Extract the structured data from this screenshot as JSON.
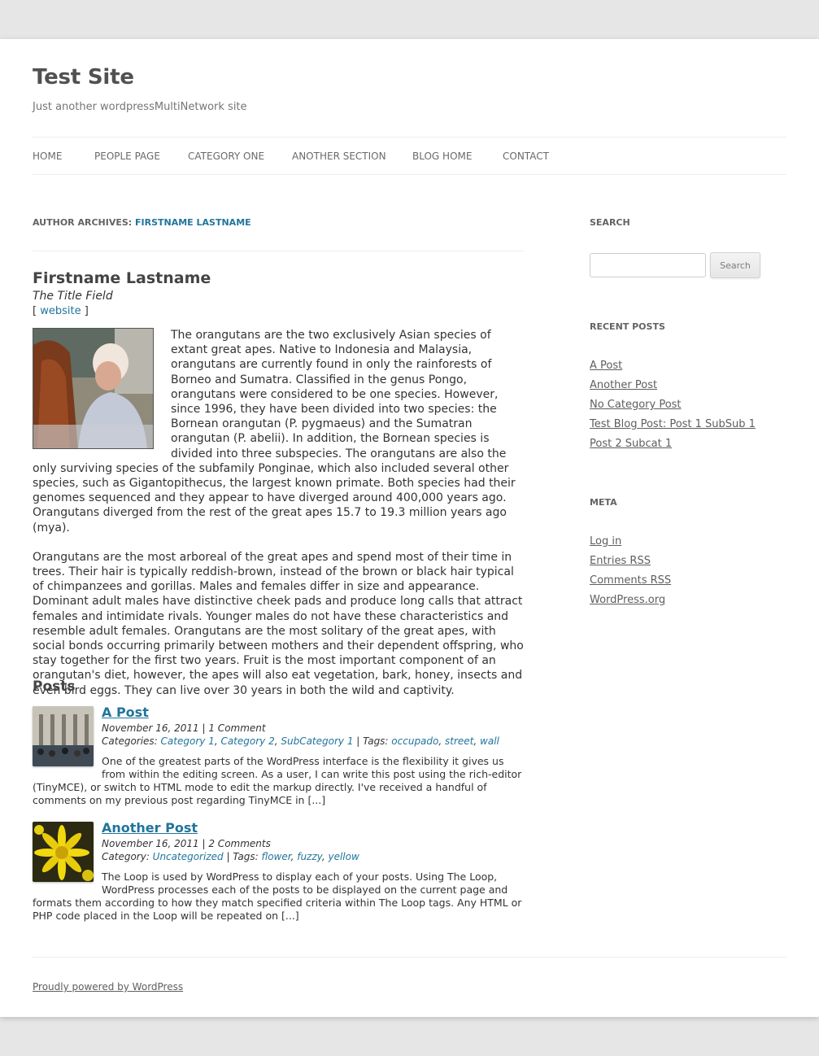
{
  "site": {
    "title": "Test Site",
    "description": "Just another wordpressMultiNetwork site"
  },
  "nav": [
    "HOME",
    "PEOPLE PAGE",
    "CATEGORY ONE",
    "ANOTHER SECTION",
    "BLOG HOME",
    "CONTACT"
  ],
  "archive": {
    "prefix": "AUTHOR ARCHIVES: ",
    "author_link": "FIRSTNAME LASTNAME"
  },
  "author": {
    "name": "Firstname Lastname",
    "title_field": "The Title Field",
    "website_open": "[ ",
    "website_label": "website",
    "website_close": " ]",
    "bio": [
      "The orangutans are the two exclusively Asian species of extant great apes. Native to Indonesia and Malaysia, orangutans are currently found in only the rainforests of Borneo and Sumatra. Classified in the genus Pongo, orangutans were considered to be one species. However, since 1996, they have been divided into two species: the Bornean orangutan (P. pygmaeus) and the Sumatran orangutan (P. abelii). In addition, the Bornean species is divided into three subspecies. The orangutans are also the only surviving species of the subfamily Ponginae, which also included several other species, such as Gigantopithecus, the largest known primate. Both species had their genomes sequenced and they appear to have diverged around 400,000 years ago. Orangutans diverged from the rest of the great apes 15.7 to 19.3 million years ago (mya).",
      "Orangutans are the most arboreal of the great apes and spend most of their time in trees. Their hair is typically reddish-brown, instead of the brown or black hair typical of chimpanzees and gorillas. Males and females differ in size and appearance. Dominant adult males have distinctive cheek pads and produce long calls that attract females and intimidate rivals. Younger males do not have these characteristics and resemble adult females. Orangutans are the most solitary of the great apes, with social bonds occurring primarily between mothers and their dependent offspring, who stay together for the first two years. Fruit is the most important component of an orangutan's diet, however, the apes will also eat vegetation, bark, honey, insects and even bird eggs. They can live over 30 years in both the wild and captivity."
    ]
  },
  "posts_heading": "Posts",
  "posts": [
    {
      "title": "A Post",
      "date": "November 16, 2011",
      "sep": " | ",
      "comments": "1 Comment",
      "cat_label": "Categories: ",
      "categories": [
        "Category 1",
        "Category 2",
        "SubCategory 1"
      ],
      "tags_label": " | Tags: ",
      "tags": [
        "occupado",
        "street",
        "wall"
      ],
      "excerpt": "One of the greatest parts of the WordPress interface is the flexibility it gives us from within the editing screen. As a user, I can write this post using the rich-editor (TinyMCE), or switch to HTML mode to edit the markup directly. I've received a handful of comments on my previous post regarding TinyMCE in [...]"
    },
    {
      "title": "Another Post",
      "date": "November 16, 2011",
      "sep": " | ",
      "comments": "2 Comments",
      "cat_label": "Category: ",
      "categories": [
        "Uncategorized"
      ],
      "tags_label": " | Tags: ",
      "tags": [
        "flower",
        "fuzzy",
        "yellow"
      ],
      "excerpt": "The Loop is used by WordPress to display each of your posts. Using The Loop, WordPress processes each of the posts to be displayed on the current page and formats them according to how they match specified criteria within The Loop tags. Any HTML or PHP code placed in the Loop will be repeated on [...]"
    }
  ],
  "sidebar": {
    "search_title": "SEARCH",
    "search_placeholder": "",
    "search_button": "Search",
    "recent_title": "RECENT POSTS",
    "recent": [
      "A Post",
      "Another Post",
      "No Category Post",
      "Test Blog Post: Post 1 SubSub 1",
      "Post 2 Subcat 1"
    ],
    "meta_title": "META",
    "meta": [
      "Log in",
      "Entries RSS",
      "Comments RSS",
      "WordPress.org"
    ]
  },
  "footer": {
    "powered": "Proudly powered by WordPress"
  },
  "colors": {
    "link": "#21759b",
    "page_bg": "#e6e6e6"
  }
}
